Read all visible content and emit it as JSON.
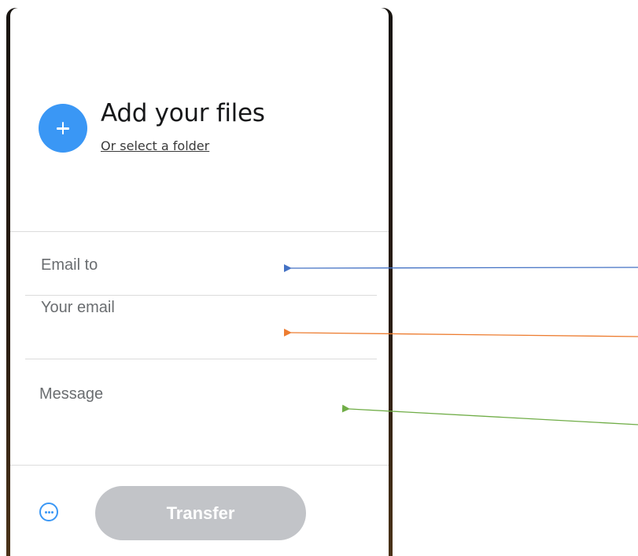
{
  "upload": {
    "title": "Add your files",
    "folder_link": "Or select a folder",
    "add_icon": "plus-icon"
  },
  "form": {
    "email_to_placeholder": "Email to",
    "your_email_placeholder": "Your email",
    "message_placeholder": "Message"
  },
  "footer": {
    "more_icon": "ellipsis-circle-icon",
    "transfer_label": "Transfer",
    "transfer_disabled": true
  },
  "colors": {
    "accent": "#3a97f5",
    "button_disabled": "#c2c4c8",
    "annotation_blue": "#4472c4",
    "annotation_orange": "#ed7d31",
    "annotation_green": "#70ad47"
  }
}
